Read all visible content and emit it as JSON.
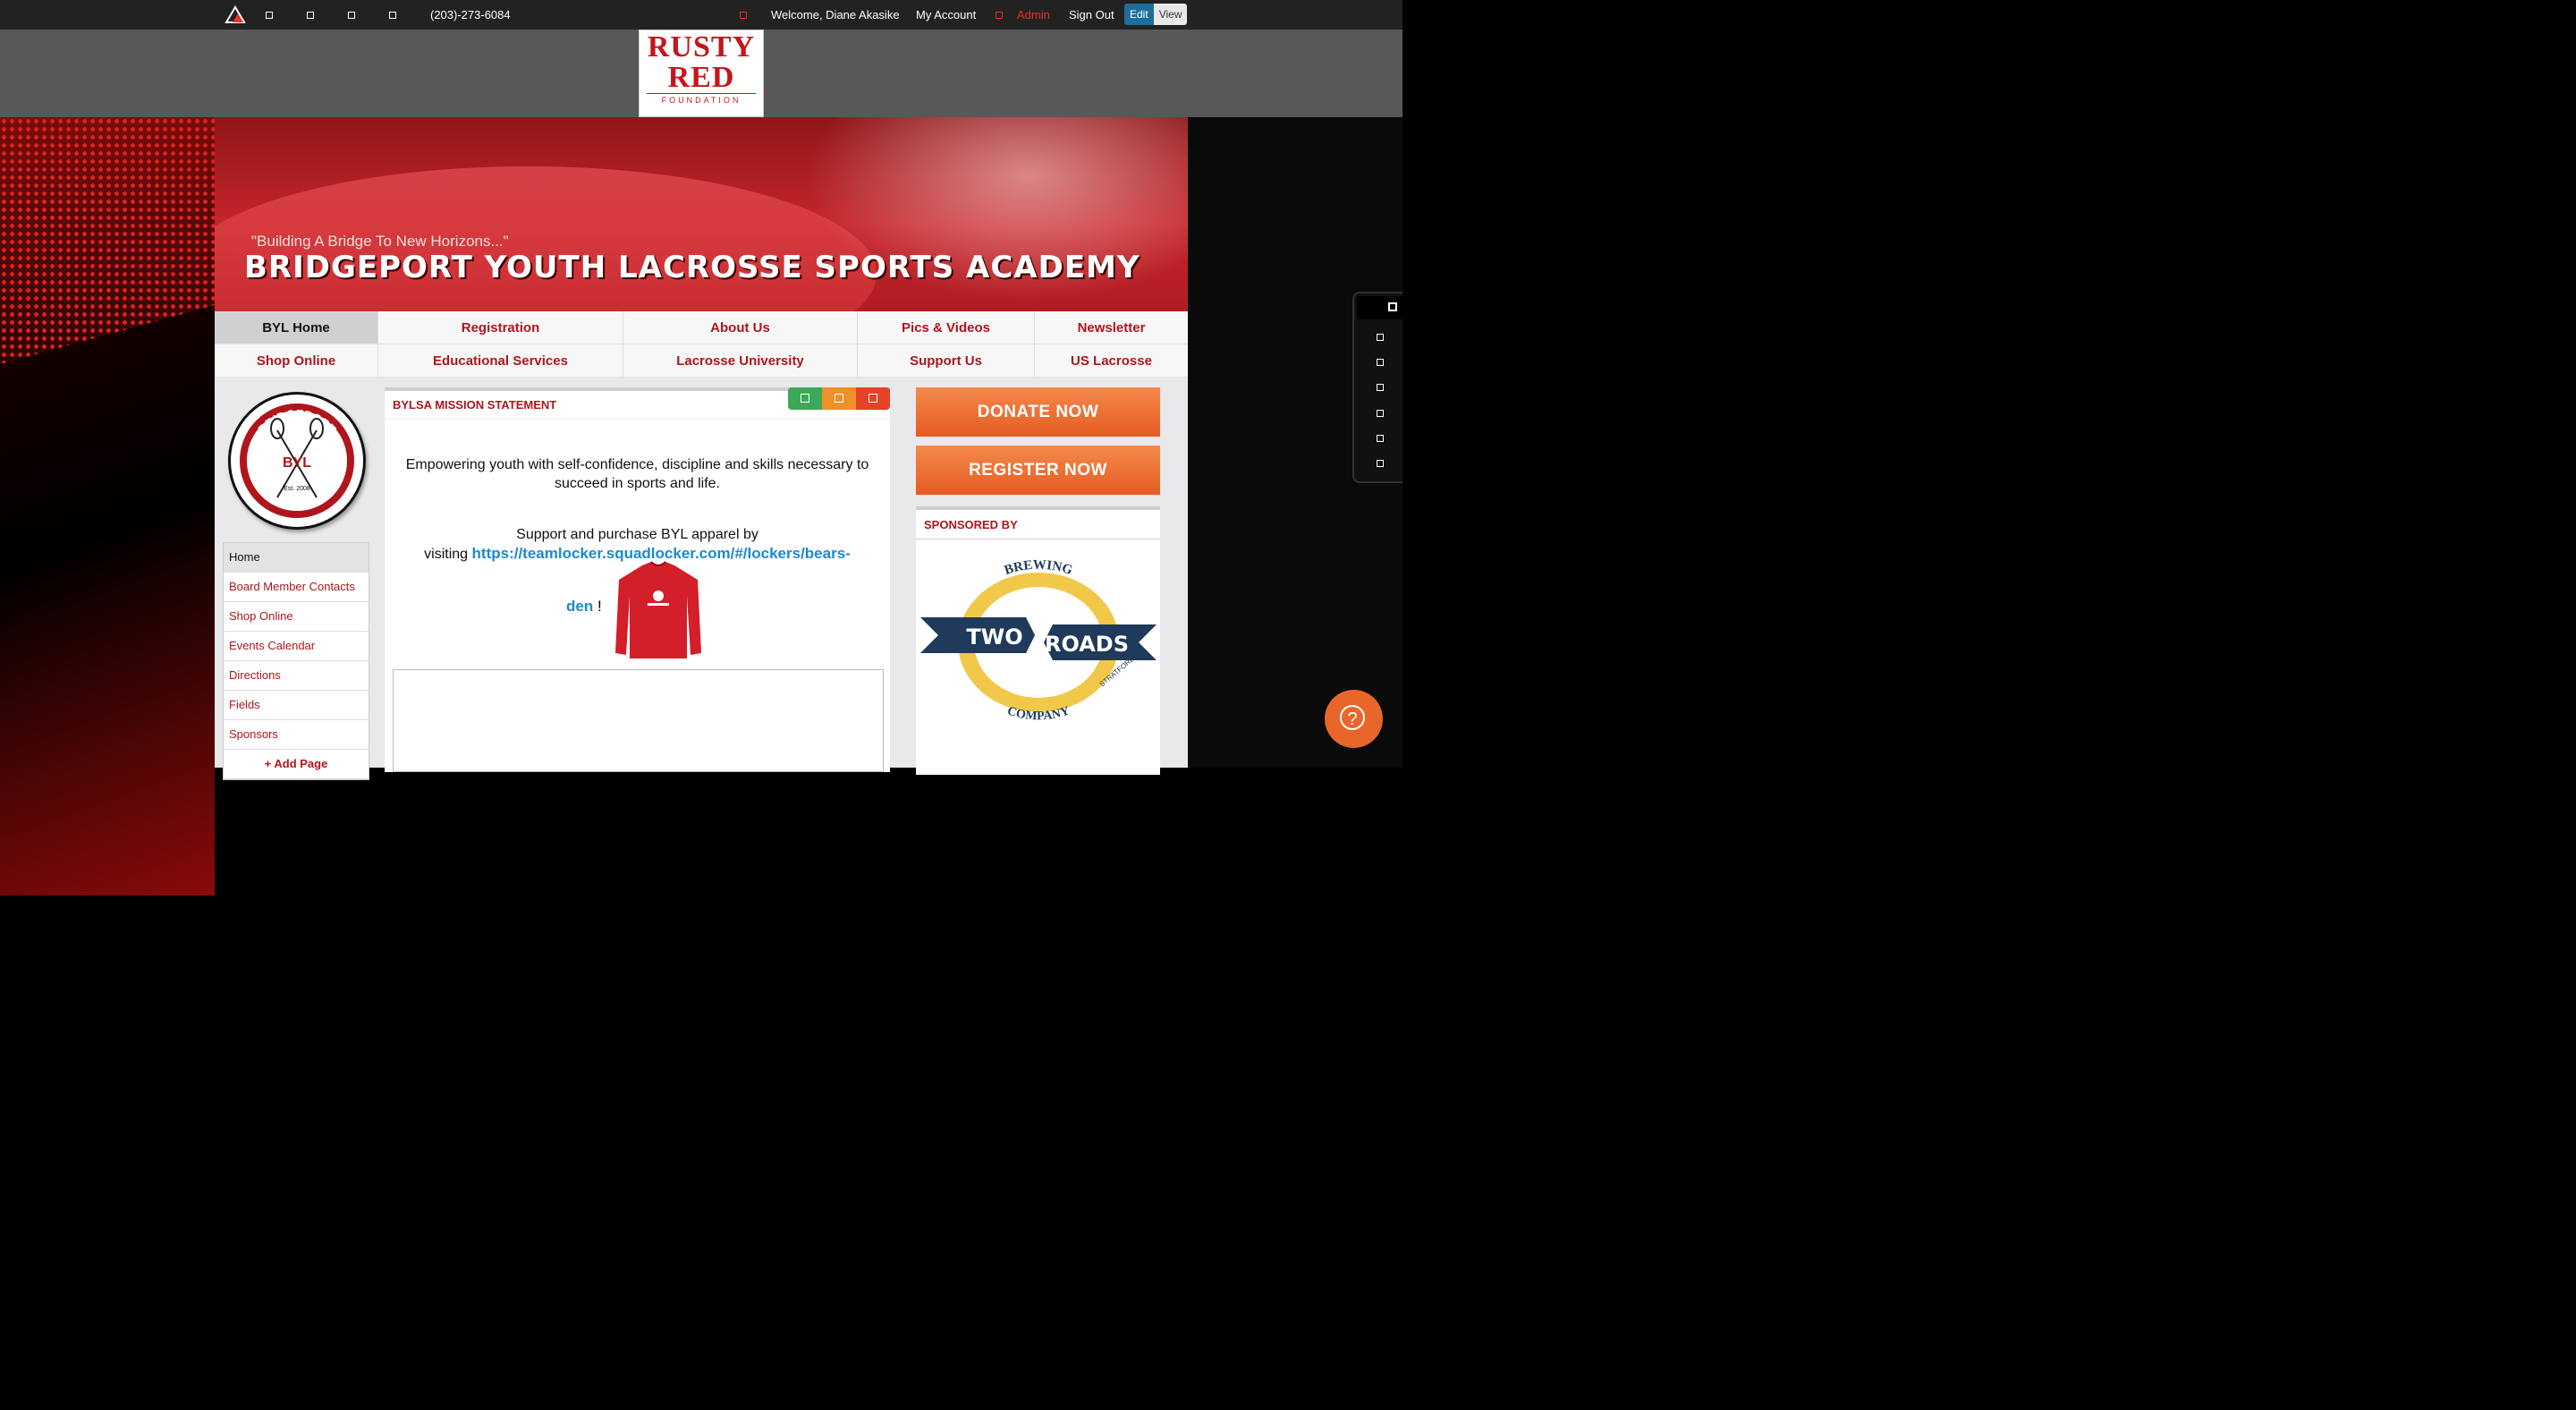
{
  "topbar": {
    "phone": "(203)-273-6084",
    "welcome": "Welcome, Diane Akasike",
    "my_account": "My Account",
    "admin": "Admin",
    "sign_out": "Sign Out",
    "edit": "Edit",
    "view": "View"
  },
  "foundation_logo": {
    "line1": "RUSTY",
    "line2": "RED",
    "line3": "FOUNDATION"
  },
  "hero": {
    "tagline": "\"Building A Bridge To New Horizons...\"",
    "title": "BRIDGEPORT YOUTH LACROSSE SPORTS ACADEMY"
  },
  "nav": {
    "row1": [
      "BYL Home",
      "Registration",
      "About Us",
      "Pics & Videos",
      "Newsletter"
    ],
    "row2": [
      "Shop Online",
      "Educational Services",
      "Lacrosse University",
      "Support Us",
      "US Lacrosse"
    ]
  },
  "crest": {
    "top_text": "BRIDGEPORT",
    "bottom_text": "YOUTH LACROSSE",
    "initials": "BYL",
    "est": "Est. 2008"
  },
  "sidenav": {
    "items": [
      "Home",
      "Board Member Contacts",
      "Shop Online",
      "Events Calendar",
      "Directions",
      "Fields",
      "Sponsors"
    ],
    "add_page": "+ Add Page"
  },
  "mission": {
    "heading": "BYLSA MISSION STATEMENT",
    "statement": "Empowering youth with self-confidence, discipline and skills necessary to succeed in sports and life.",
    "apparel_line1": "Support and purchase BYL apparel by",
    "apparel_visiting": "visiting",
    "apparel_link": "https://teamlocker.squadlocker.com/#/lockers/bears-",
    "apparel_link_end": "den",
    "apparel_bang": "!"
  },
  "right": {
    "donate": "DONATE NOW",
    "register": "REGISTER NOW",
    "sponsored_by": "SPONSORED BY",
    "sponsor_word1": "TWO",
    "sponsor_word2": "ROADS",
    "sponsor_top": "BREWING",
    "sponsor_bottom": "COMPANY",
    "sponsor_location": "STRATFORD CT"
  },
  "colors": {
    "brand_red": "#b0151b",
    "link_blue": "#1a8ad0",
    "orange": "#e55b22"
  }
}
